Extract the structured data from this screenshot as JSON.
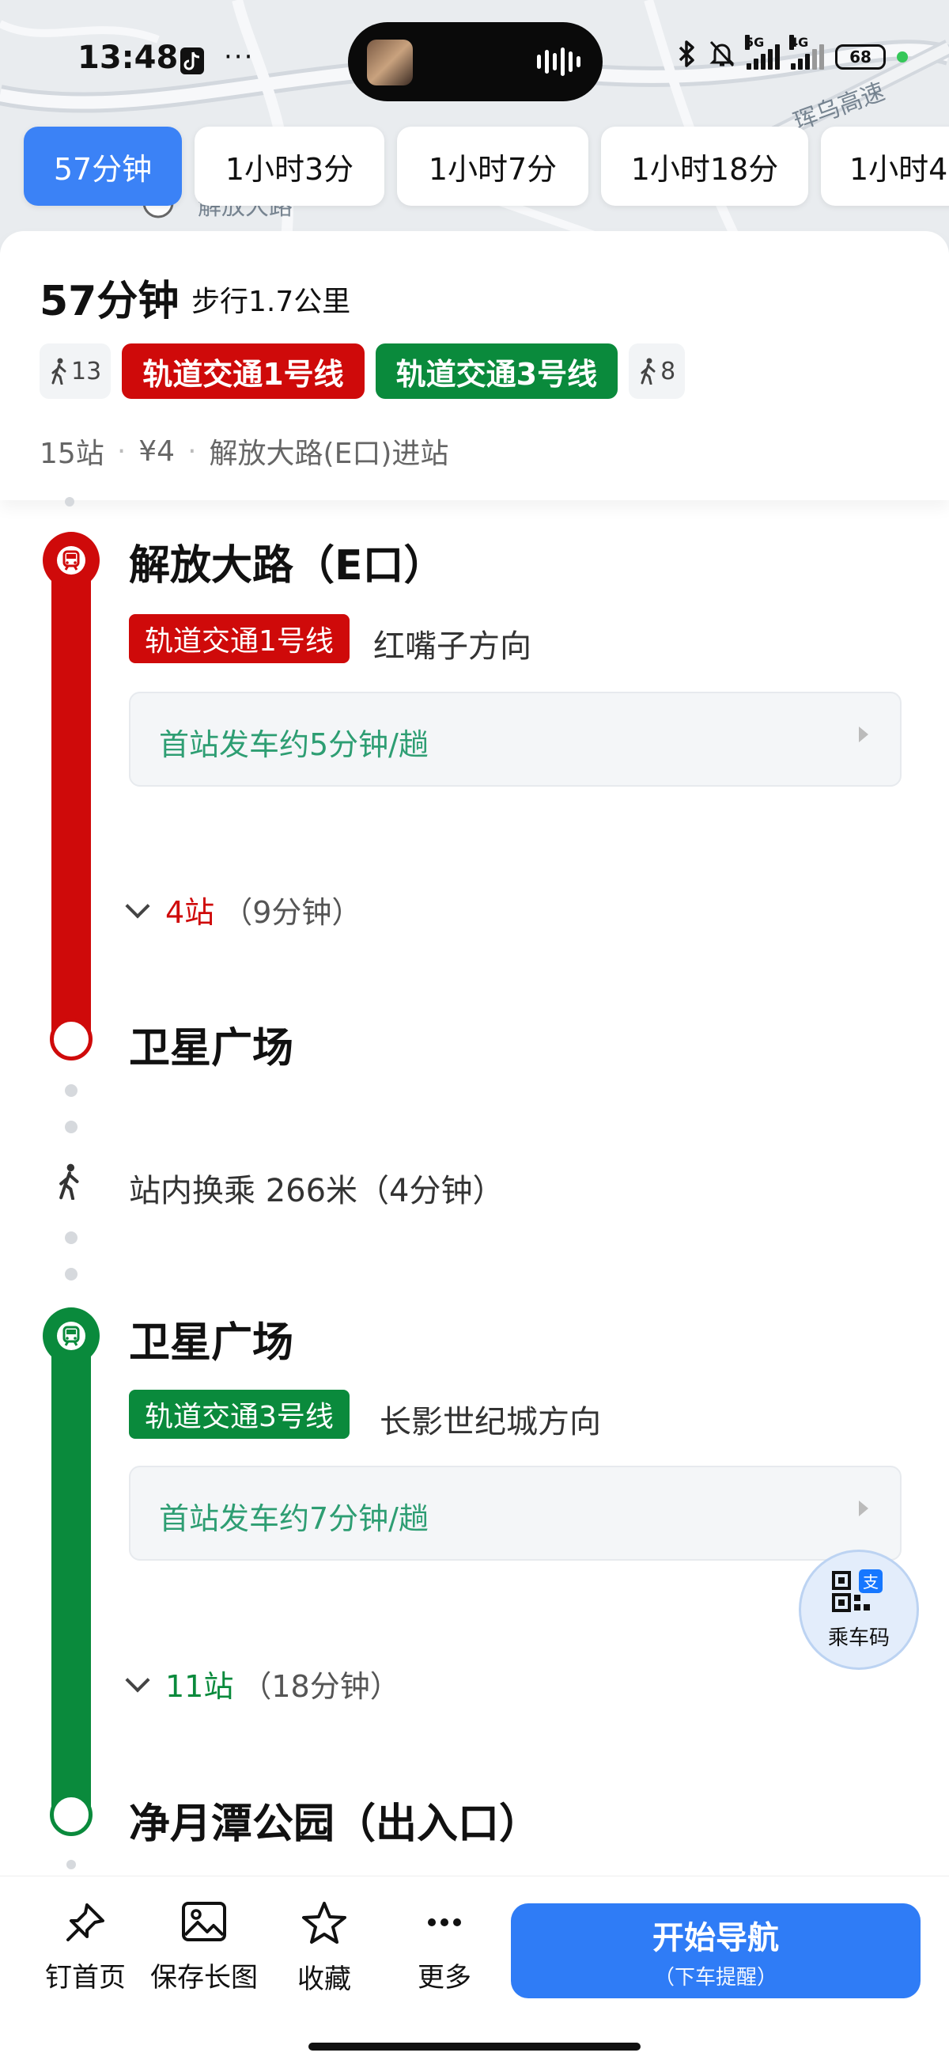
{
  "status_bar": {
    "time": "13:48",
    "extra": "···",
    "network1": "5G",
    "network2": "4G",
    "battery": "68"
  },
  "map": {
    "road_label_1": "解放大路",
    "road_label_2": "珲乌高速"
  },
  "route_tabs": [
    {
      "label": "57分钟",
      "active": true
    },
    {
      "label": "1小时3分",
      "active": false
    },
    {
      "label": "1小时7分",
      "active": false
    },
    {
      "label": "1小时18分",
      "active": false
    },
    {
      "label": "1小时4",
      "active": false
    }
  ],
  "summary": {
    "duration": "57分钟",
    "walk": "步行1.7公里",
    "walk_start": "13",
    "line1": "轨道交通1号线",
    "line2": "轨道交通3号线",
    "walk_end": "8",
    "stops": "15站",
    "price": "¥4",
    "entrance": "解放大路(E口)进站"
  },
  "colors": {
    "line1": "#cf0a0a",
    "line3": "#0a8a3c",
    "accent": "#2f7cf6"
  },
  "segment1": {
    "start_station": "解放大路（E口）",
    "line": "轨道交通1号线",
    "direction": "红嘴子方向",
    "frequency": "首站发车约5分钟/趟",
    "stops_count": "4站",
    "stops_time": "（9分钟）",
    "end_station": "卫星广场"
  },
  "transfer": {
    "text": "站内换乘 266米（4分钟）"
  },
  "segment2": {
    "start_station": "卫星广场",
    "line": "轨道交通3号线",
    "direction": "长影世纪城方向",
    "frequency": "首站发车约7分钟/趟",
    "stops_count": "11站",
    "stops_time": "（18分钟）",
    "end_station": "净月潭公园（出入口）"
  },
  "ride_code": {
    "label": "乘车码"
  },
  "bottom_bar": {
    "pin": "钉首页",
    "save": "保存长图",
    "favorite": "收藏",
    "more": "更多",
    "nav_main": "开始导航",
    "nav_sub": "（下车提醒）"
  }
}
